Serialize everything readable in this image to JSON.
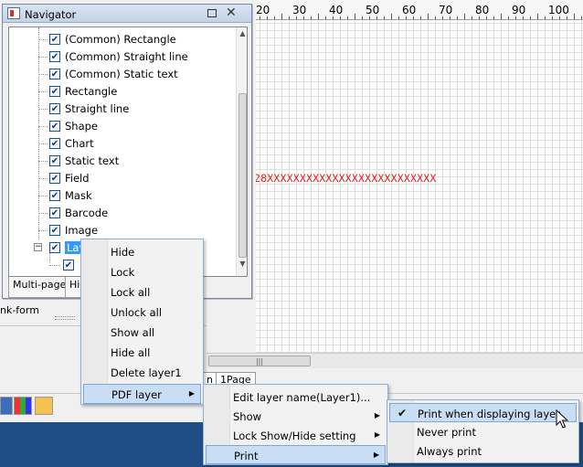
{
  "ruler": {
    "numbers": [
      "20",
      "30",
      "40",
      "50",
      "60",
      "70",
      "80",
      "90",
      "100"
    ]
  },
  "canvas": {
    "field_text": "28XXXXXXXXXXXXXXXXXXXXXXXXXX"
  },
  "left_panel": {
    "link_form_label": "nk-form"
  },
  "navigator": {
    "title": "Navigator",
    "tree": [
      {
        "label": "(Common) Rectangle",
        "checked": true
      },
      {
        "label": "(Common) Straight line",
        "checked": true
      },
      {
        "label": "(Common) Static text",
        "checked": true
      },
      {
        "label": "Rectangle",
        "checked": true
      },
      {
        "label": "Straight line",
        "checked": true
      },
      {
        "label": "Shape",
        "checked": true
      },
      {
        "label": "Chart",
        "checked": true
      },
      {
        "label": "Static text",
        "checked": true
      },
      {
        "label": "Field",
        "checked": true
      },
      {
        "label": "Mask",
        "checked": true
      },
      {
        "label": "Barcode",
        "checked": true
      },
      {
        "label": "Image",
        "checked": true
      }
    ],
    "layer_node": {
      "label": "Lay",
      "checked": true,
      "selected": true
    },
    "tabs": [
      "Multi-page",
      "Hi"
    ]
  },
  "page_tabs": [
    "n",
    "1Page"
  ],
  "context_menu_1": {
    "items": [
      "Hide",
      "Lock",
      "Lock all",
      "Unlock all",
      "Show all",
      "Hide all",
      "Delete layer1"
    ],
    "pdf_layer": "PDF layer"
  },
  "context_menu_2": {
    "items": [
      {
        "label": "Edit layer name(Layer1)...",
        "submenu": false
      },
      {
        "label": "Show",
        "submenu": true
      },
      {
        "label": "Lock Show/Hide setting",
        "submenu": true
      },
      {
        "label": "Print",
        "submenu": true,
        "highlighted": true
      }
    ]
  },
  "context_menu_3": {
    "items": [
      {
        "label": "Print when displaying layer",
        "checked": true,
        "highlighted": true
      },
      {
        "label": "Never print",
        "checked": false
      },
      {
        "label": "Always print",
        "checked": false
      }
    ]
  },
  "icons": {
    "checkmark": "✔",
    "submenu_arrow": "▶",
    "close": "✕",
    "scroll_up": "▲",
    "scroll_down": "▼"
  }
}
